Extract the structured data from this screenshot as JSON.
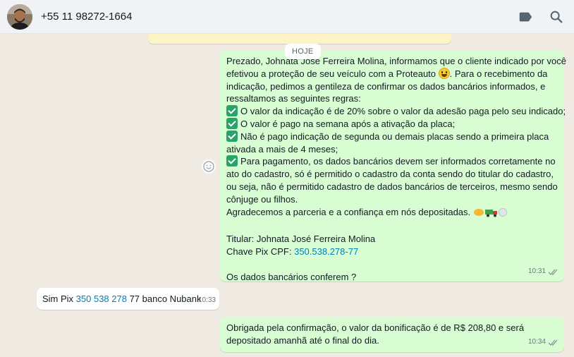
{
  "header": {
    "contact_phone": "+55 11 98272-1664",
    "icons": [
      "label-icon",
      "search-icon"
    ]
  },
  "chat": {
    "date_divider": "HOJE",
    "messages": [
      {
        "direction": "outgoing",
        "lines": [
          "Prezado, Johnata José Ferreira Molina, informamos que o cliente indicado por você",
          "efetivou a proteção de seu veículo com a Proteauto",
          ". Para o recebimento da",
          "indicação, pedimos a gentileza de confirmar os dados bancários informados, e",
          "ressaltamos as seguintes regras:",
          "O valor da indicação é de 20% sobre o valor da adesão paga pelo seu indicado;",
          "O valor é pago na semana após a ativação da placa;",
          "Não é pago indicação de segunda ou demais placas sendo a primeira placa",
          "ativada a mais de 4 meses;",
          "Para pagamento, os dados bancários devem ser informados corretamente no",
          "ato do cadastro, só é permitido o cadastro da conta sendo do titular do cadastro,",
          "ou seja, não é permitido cadastro de dados bancários de terceiros, mesmo sendo",
          "cônjuge ou filhos.",
          "Agradecemos a parceria e a confiança em nós depositadas.",
          "Titular: Johnata José Ferreira Molina",
          "Chave Pix CPF: ",
          "350.538.278-77",
          "Os dados bancários conferem ?"
        ],
        "time": "10:31"
      },
      {
        "direction": "incoming",
        "prefix": "Sim Pix ",
        "link": "350 538 278",
        "suffix": " 77 banco Nubank",
        "time": "10:33"
      },
      {
        "direction": "outgoing",
        "lines": [
          "Obrigada pela confirmação, o valor da bonificação é de R$ 208,80 e será",
          "depositado amanhã até o final do dia."
        ],
        "time": "10:34"
      }
    ]
  },
  "colors": {
    "outgoing_bubble": "#d9fdd3",
    "incoming_bubble": "#ffffff",
    "background": "#efeae2",
    "link": "#027eb5",
    "check_emoji": "#29a36a"
  }
}
